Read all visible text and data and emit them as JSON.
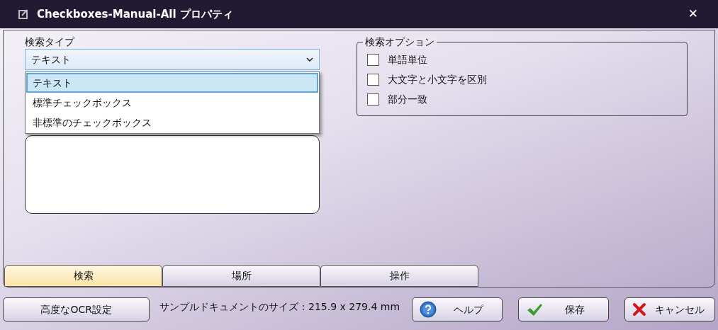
{
  "window": {
    "title": "Checkboxes-Manual-All プロパティ",
    "close": "✕"
  },
  "search_type": {
    "label": "検索タイプ",
    "value": "テキスト",
    "expanded": true,
    "options": [
      {
        "label": "テキスト",
        "selected": true
      },
      {
        "label": "標準チェックボックス",
        "selected": false
      },
      {
        "label": "非標準のチェックボックス",
        "selected": false
      }
    ]
  },
  "search_options": {
    "title": "検索オプション",
    "items": [
      {
        "label": "単語単位",
        "checked": false
      },
      {
        "label": "大文字と小文字を区別",
        "checked": false
      },
      {
        "label": "部分一致",
        "checked": false
      }
    ]
  },
  "tabs": [
    {
      "label": "検索",
      "selected": true
    },
    {
      "label": "場所",
      "selected": false
    },
    {
      "label": "操作",
      "selected": false
    }
  ],
  "footer": {
    "ocr_button": "高度なOCR設定",
    "sample_size": "サンプルドキュメントのサイズ : 215.9 x 279.4 mm",
    "buttons": [
      {
        "kind": "help",
        "label": "ヘルプ"
      },
      {
        "kind": "save",
        "label": "保存"
      },
      {
        "kind": "cancel",
        "label": "キャンセル"
      }
    ]
  }
}
